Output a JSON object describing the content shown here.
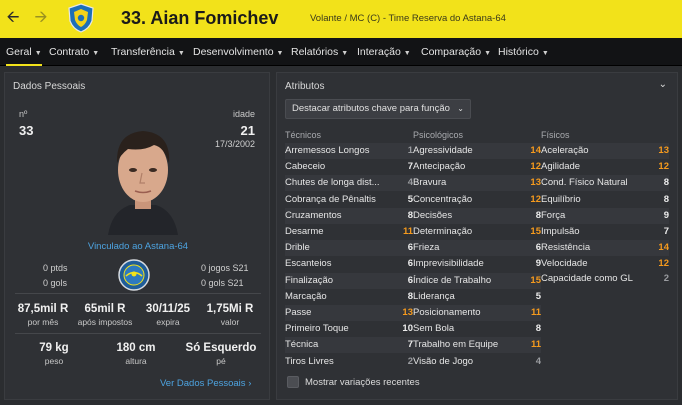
{
  "header": {
    "number_name": "33. Aian Fomichev",
    "subtitle": "Volante / MC (C) - Time Reserva do Astana-64",
    "back_icon": "arrow-left-icon",
    "forward_icon": "arrow-right-icon"
  },
  "menu": [
    {
      "label": "Geral",
      "active": true
    },
    {
      "label": "Contrato"
    },
    {
      "label": "Transferência"
    },
    {
      "label": "Desenvolvimento"
    },
    {
      "label": "Relatórios"
    },
    {
      "label": "Interação"
    },
    {
      "label": "Comparação"
    },
    {
      "label": "Histórico"
    }
  ],
  "personal": {
    "title": "Dados Pessoais",
    "number_label": "nº",
    "number_value": "33",
    "age_label": "idade",
    "age_value": "21",
    "birth_date": "17/3/2002",
    "linked": "Vinculado ao Astana-64",
    "pts": "0 ptds",
    "goals": "0 gols",
    "games": "0 jogos S21",
    "goals_s21": "0 gols S21",
    "wage": {
      "value": "87,5mil R",
      "label": "por mês"
    },
    "net": {
      "value": "65mil R",
      "label": "após impostos"
    },
    "expires": {
      "value": "30/11/25",
      "label": "expira"
    },
    "market_value": {
      "value": "1,75Mi R",
      "label": "valor"
    },
    "weight": {
      "value": "79 kg",
      "label": "peso"
    },
    "height": {
      "value": "180 cm",
      "label": "altura"
    },
    "foot": {
      "value": "Só Esquerdo",
      "label": "pé"
    },
    "more_link": "Ver Dados Pessoais"
  },
  "attributes": {
    "title": "Atributos",
    "dropdown": "Destacar atributos chave para função",
    "technical_title": "Técnicos",
    "mental_title": "Psicológicos",
    "physical_title": "Físicos",
    "technical": [
      {
        "name": "Arremessos Longos",
        "value": "1"
      },
      {
        "name": "Cabeceio",
        "value": "7"
      },
      {
        "name": "Chutes de longa dist...",
        "value": "4"
      },
      {
        "name": "Cobrança de Pênaltis",
        "value": "5"
      },
      {
        "name": "Cruzamentos",
        "value": "8"
      },
      {
        "name": "Desarme",
        "value": "11"
      },
      {
        "name": "Drible",
        "value": "6"
      },
      {
        "name": "Escanteios",
        "value": "6"
      },
      {
        "name": "Finalização",
        "value": "6"
      },
      {
        "name": "Marcação",
        "value": "8"
      },
      {
        "name": "Passe",
        "value": "13"
      },
      {
        "name": "Primeiro Toque",
        "value": "10"
      },
      {
        "name": "Técnica",
        "value": "7"
      },
      {
        "name": "Tiros Livres",
        "value": "2"
      }
    ],
    "mental": [
      {
        "name": "Agressividade",
        "value": "14"
      },
      {
        "name": "Antecipação",
        "value": "12"
      },
      {
        "name": "Bravura",
        "value": "13"
      },
      {
        "name": "Concentração",
        "value": "12"
      },
      {
        "name": "Decisões",
        "value": "8"
      },
      {
        "name": "Determinação",
        "value": "15"
      },
      {
        "name": "Frieza",
        "value": "6"
      },
      {
        "name": "Imprevisibilidade",
        "value": "9"
      },
      {
        "name": "Índice de Trabalho",
        "value": "15"
      },
      {
        "name": "Liderança",
        "value": "5"
      },
      {
        "name": "Posicionamento",
        "value": "11"
      },
      {
        "name": "Sem Bola",
        "value": "8"
      },
      {
        "name": "Trabalho em Equipe",
        "value": "11"
      },
      {
        "name": "Visão de Jogo",
        "value": "4"
      }
    ],
    "physical": [
      {
        "name": "Aceleração",
        "value": "13"
      },
      {
        "name": "Agilidade",
        "value": "12"
      },
      {
        "name": "Cond. Físico Natural",
        "value": "8"
      },
      {
        "name": "Equilíbrio",
        "value": "8"
      },
      {
        "name": "Força",
        "value": "9"
      },
      {
        "name": "Impulsão",
        "value": "7"
      },
      {
        "name": "Resistência",
        "value": "14"
      },
      {
        "name": "Velocidade",
        "value": "12"
      }
    ],
    "gk_capacity": {
      "name": "Capacidade como GL",
      "value": "2"
    },
    "checkbox_label": "Mostrar variações recentes"
  },
  "colors": {
    "header_yellow": "#f2e21a",
    "link_blue": "#4da3e0",
    "highlight_orange": "#f59a1d"
  }
}
